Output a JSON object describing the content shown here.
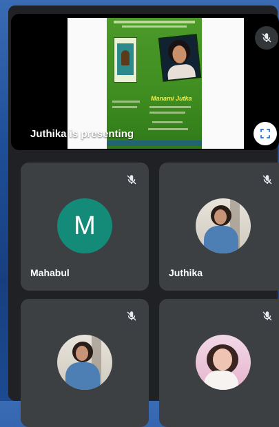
{
  "presentation": {
    "label": "Juthika is presenting",
    "mute_icon": "mic-off-icon",
    "expand_icon": "fullscreen-icon",
    "slide": {
      "poster_name": "Manami Jutka"
    }
  },
  "participants": [
    {
      "name": "Mahabul",
      "avatar_letter": "M",
      "avatar_color": "#148a78",
      "muted": true
    },
    {
      "name": "Juthika",
      "avatar_type": "photo",
      "muted": true
    },
    {
      "name": "",
      "avatar_type": "photo",
      "muted": true
    },
    {
      "name": "",
      "avatar_type": "photo",
      "muted": true
    }
  ],
  "colors": {
    "tile_bg": "#3c4043",
    "frame_bg": "#202124",
    "accent_teal": "#148a78"
  }
}
